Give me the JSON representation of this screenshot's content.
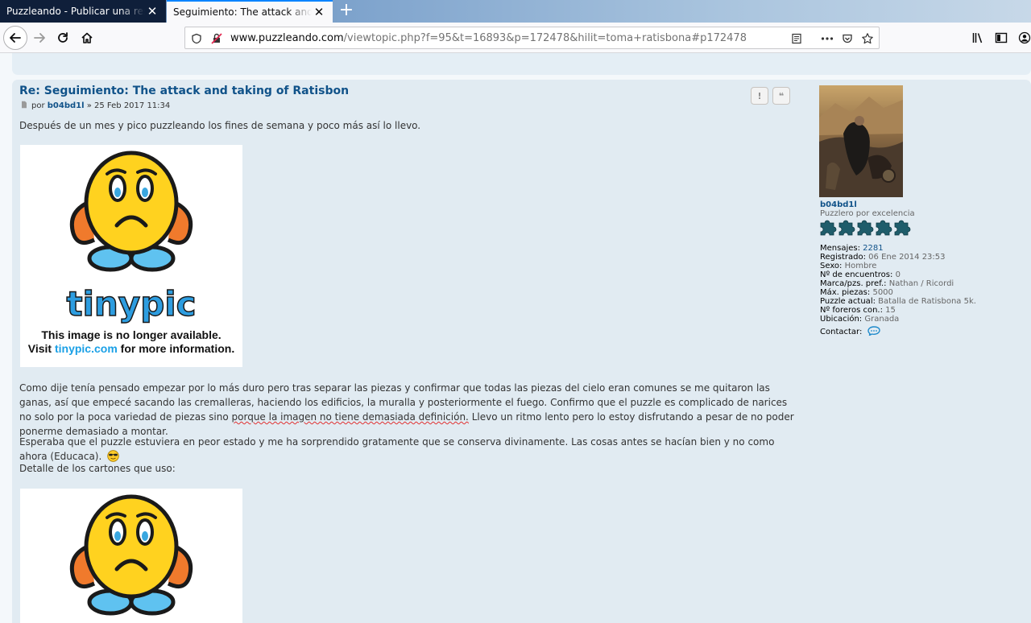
{
  "browser": {
    "tabs": [
      {
        "title": "Puzzleando - Publicar una respuesta",
        "active": false
      },
      {
        "title": "Seguimiento: The attack and taking of Ratisbon",
        "active": true
      }
    ],
    "url": {
      "host": "www.puzzleando.com",
      "path": "/viewtopic.php?f=95&t=16893&p=172478&hilit=toma+ratisbona#p172478"
    }
  },
  "post": {
    "title": "Re: Seguimiento: The attack and taking of Ratisbon",
    "meta": {
      "by": "por",
      "author": "b04bd1l",
      "date": "» 25 Feb 2017 11:34"
    },
    "buttons": {
      "report": "!",
      "quote": "❝"
    },
    "paragraphs": {
      "p1": "Después de un mes y pico puzzleando los fines de semana y poco más así lo llevo.",
      "p2a": "Como dije tenía pensado empezar por lo más duro pero tras separar las piezas y confirmar que todas las piezas del cielo eran comunes se me quitaron las ganas, así que empecé sacando las cremalleras, haciendo los edificios, la muralla y posteriormente el fuego. Confirmo que el puzzle es complicado de narices no solo por la poca variedad de piezas sino ",
      "p2b": "porque la imagen no tiene demasiada definición.",
      "p2c": " Llevo un ritmo lento pero lo estoy disfrutando a pesar de no poder ponerme demasiado a montar.",
      "p3": "Esperaba que el puzzle estuviera en peor estado y me ha sorprendido gratamente que se conserva divinamente. Las cosas antes se hacían bien y no como ahora (Educaca).",
      "p4": "Detalle de los cartones que uso:"
    },
    "broken_image": {
      "logo": "tinypic",
      "line1": "This image is no longer available.",
      "line2_pre": "Visit ",
      "line2_link": "tinypic.com",
      "line2_post": " for more information."
    }
  },
  "profile": {
    "username": "b04bd1l",
    "rank": "Puzzlero por excelencia",
    "rank_stars": 5,
    "fields": [
      {
        "label": "Mensajes:",
        "value": "2281",
        "link": true
      },
      {
        "label": "Registrado:",
        "value": "06 Ene 2014 23:53",
        "link": false
      },
      {
        "label": "Sexo:",
        "value": "Hombre",
        "link": false
      },
      {
        "label": "Nº de encuentros:",
        "value": "0",
        "link": false
      },
      {
        "label": "Marca/pzs. pref.:",
        "value": "Nathan / Ricordi",
        "link": false
      },
      {
        "label": "Máx. piezas:",
        "value": "5000",
        "link": false
      },
      {
        "label": "Puzzle actual:",
        "value": "Batalla de Ratisbona 5k.",
        "link": false
      },
      {
        "label": "Nº foreros con.:",
        "value": "15",
        "link": false
      },
      {
        "label": "Ubicación:",
        "value": "Granada",
        "link": false
      }
    ],
    "contact_label": "Contactar:"
  }
}
